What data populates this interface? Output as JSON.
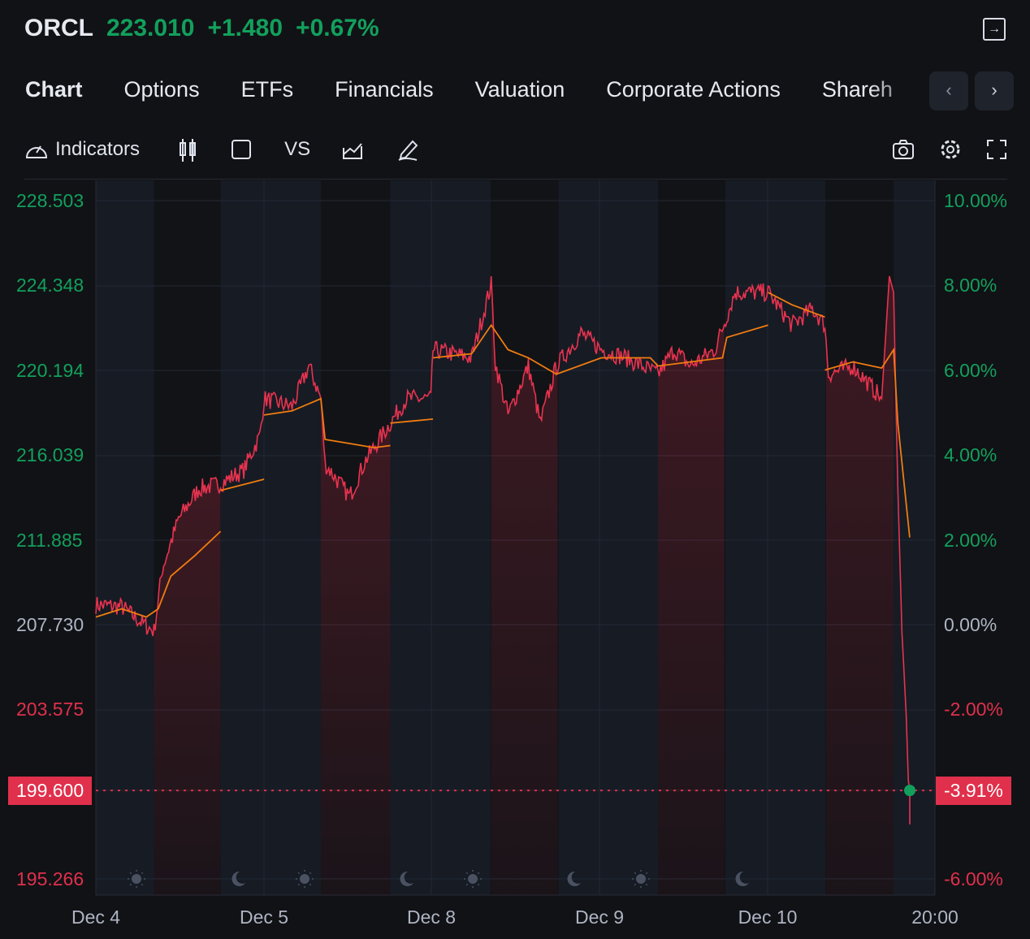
{
  "header": {
    "symbol": "ORCL",
    "price": "223.010",
    "change": "+1.480",
    "change_pct": "+0.67%"
  },
  "tabs": [
    "Chart",
    "Options",
    "ETFs",
    "Financials",
    "Valuation",
    "Corporate Actions",
    "Shareh"
  ],
  "toolbar": {
    "indicators": "Indicators",
    "vs": "VS"
  },
  "colors": {
    "up": "#12a05c",
    "down": "#e0304b",
    "line": "#e8334f",
    "ma": "#f07c10"
  },
  "chart_data": {
    "type": "line",
    "left_axis": [
      "228.503",
      "224.348",
      "220.194",
      "216.039",
      "211.885",
      "207.730",
      "203.575",
      "199.600",
      "195.266"
    ],
    "left_axis_values": [
      228.503,
      224.348,
      220.194,
      216.039,
      211.885,
      207.73,
      203.575,
      195.266
    ],
    "right_axis": [
      "10.00%",
      "8.00%",
      "6.00%",
      "4.00%",
      "2.00%",
      "0.00%",
      "-2.00%",
      "-6.00%"
    ],
    "x_labels": [
      "Dec 4",
      "Dec 5",
      "Dec 8",
      "Dec 9",
      "Dec 10",
      "20:00"
    ],
    "ylim": [
      195.266,
      228.503
    ],
    "xlim_hours": [
      0,
      119.7
    ],
    "last_price": "199.600",
    "last_pct": "-3.91%",
    "regular_sessions_hours": [
      [
        8.3,
        17.8
      ],
      [
        32.1,
        42
      ],
      [
        56.3,
        66
      ],
      [
        80.2,
        89.8
      ],
      [
        104.1,
        113.8
      ]
    ],
    "price": [
      [
        0,
        208.7
      ],
      [
        3.7,
        208.6
      ],
      [
        6.6,
        207.8
      ],
      [
        8.3,
        207.4
      ],
      [
        9.5,
        210.5
      ],
      [
        11.8,
        212.9
      ],
      [
        14.7,
        214.4
      ],
      [
        17.6,
        214.6
      ],
      [
        21.1,
        215.3
      ],
      [
        23.4,
        217.0
      ],
      [
        24,
        218.8
      ],
      [
        28,
        218.4
      ],
      [
        30.4,
        220.4
      ],
      [
        32.1,
        218.8
      ],
      [
        32.7,
        215.6
      ],
      [
        36.2,
        214.0
      ],
      [
        38.5,
        215.8
      ],
      [
        42,
        217.6
      ],
      [
        44.3,
        218.8
      ],
      [
        47.8,
        218.8
      ],
      [
        48.1,
        221.2
      ],
      [
        53.6,
        220.8
      ],
      [
        56.4,
        224.4
      ],
      [
        57,
        220.5
      ],
      [
        58.8,
        218.0
      ],
      [
        61.7,
        220.4
      ],
      [
        63.4,
        217.6
      ],
      [
        65.7,
        220.4
      ],
      [
        69.2,
        222.0
      ],
      [
        72.1,
        221.2
      ],
      [
        75.6,
        220.8
      ],
      [
        80.2,
        220.0
      ],
      [
        82.5,
        221.2
      ],
      [
        84.8,
        220.4
      ],
      [
        88.3,
        221.2
      ],
      [
        91.2,
        224.0
      ],
      [
        95.9,
        224.0
      ],
      [
        99.3,
        222.4
      ],
      [
        102.2,
        223.2
      ],
      [
        104,
        222.4
      ],
      [
        104.5,
        220.0
      ],
      [
        108,
        220.4
      ],
      [
        112.1,
        218.8
      ],
      [
        113.2,
        224.8
      ],
      [
        113.8,
        224.0
      ],
      [
        114.4,
        214.4
      ],
      [
        115,
        207.3
      ],
      [
        115.6,
        203.3
      ],
      [
        115.9,
        200.1
      ],
      [
        116.1,
        199.6
      ]
    ],
    "ma_segments": [
      [
        [
          0,
          208.1
        ],
        [
          3.7,
          208.5
        ],
        [
          7.2,
          208.1
        ],
        [
          8.9,
          208.5
        ],
        [
          10.7,
          210.1
        ],
        [
          14.1,
          211.1
        ],
        [
          17.8,
          212.3
        ]
      ],
      [
        [
          17.8,
          214.3
        ],
        [
          24,
          214.85
        ]
      ],
      [
        [
          24,
          218.0
        ],
        [
          28,
          218.2
        ],
        [
          32.1,
          218.8
        ],
        [
          32.7,
          216.8
        ],
        [
          36.2,
          216.6
        ],
        [
          39.7,
          216.4
        ],
        [
          42,
          216.5
        ]
      ],
      [
        [
          42,
          217.6
        ],
        [
          48.1,
          217.8
        ]
      ],
      [
        [
          48.1,
          220.8
        ],
        [
          53.6,
          221.0
        ],
        [
          56.4,
          222.4
        ],
        [
          58.8,
          221.2
        ],
        [
          61.7,
          220.8
        ],
        [
          65.7,
          220.0
        ],
        [
          72.1,
          220.8
        ],
        [
          79.1,
          220.8
        ],
        [
          80.2,
          220.4
        ],
        [
          89.4,
          220.8
        ],
        [
          90,
          221.8
        ],
        [
          95.9,
          222.4
        ]
      ],
      [
        [
          95.9,
          224.0
        ],
        [
          99.3,
          223.4
        ],
        [
          104,
          222.8
        ]
      ],
      [
        [
          104,
          220.2
        ],
        [
          108,
          220.6
        ],
        [
          112.1,
          220.3
        ],
        [
          113.8,
          221.2
        ],
        [
          114.4,
          217.6
        ],
        [
          116.1,
          212.0
        ]
      ]
    ]
  }
}
